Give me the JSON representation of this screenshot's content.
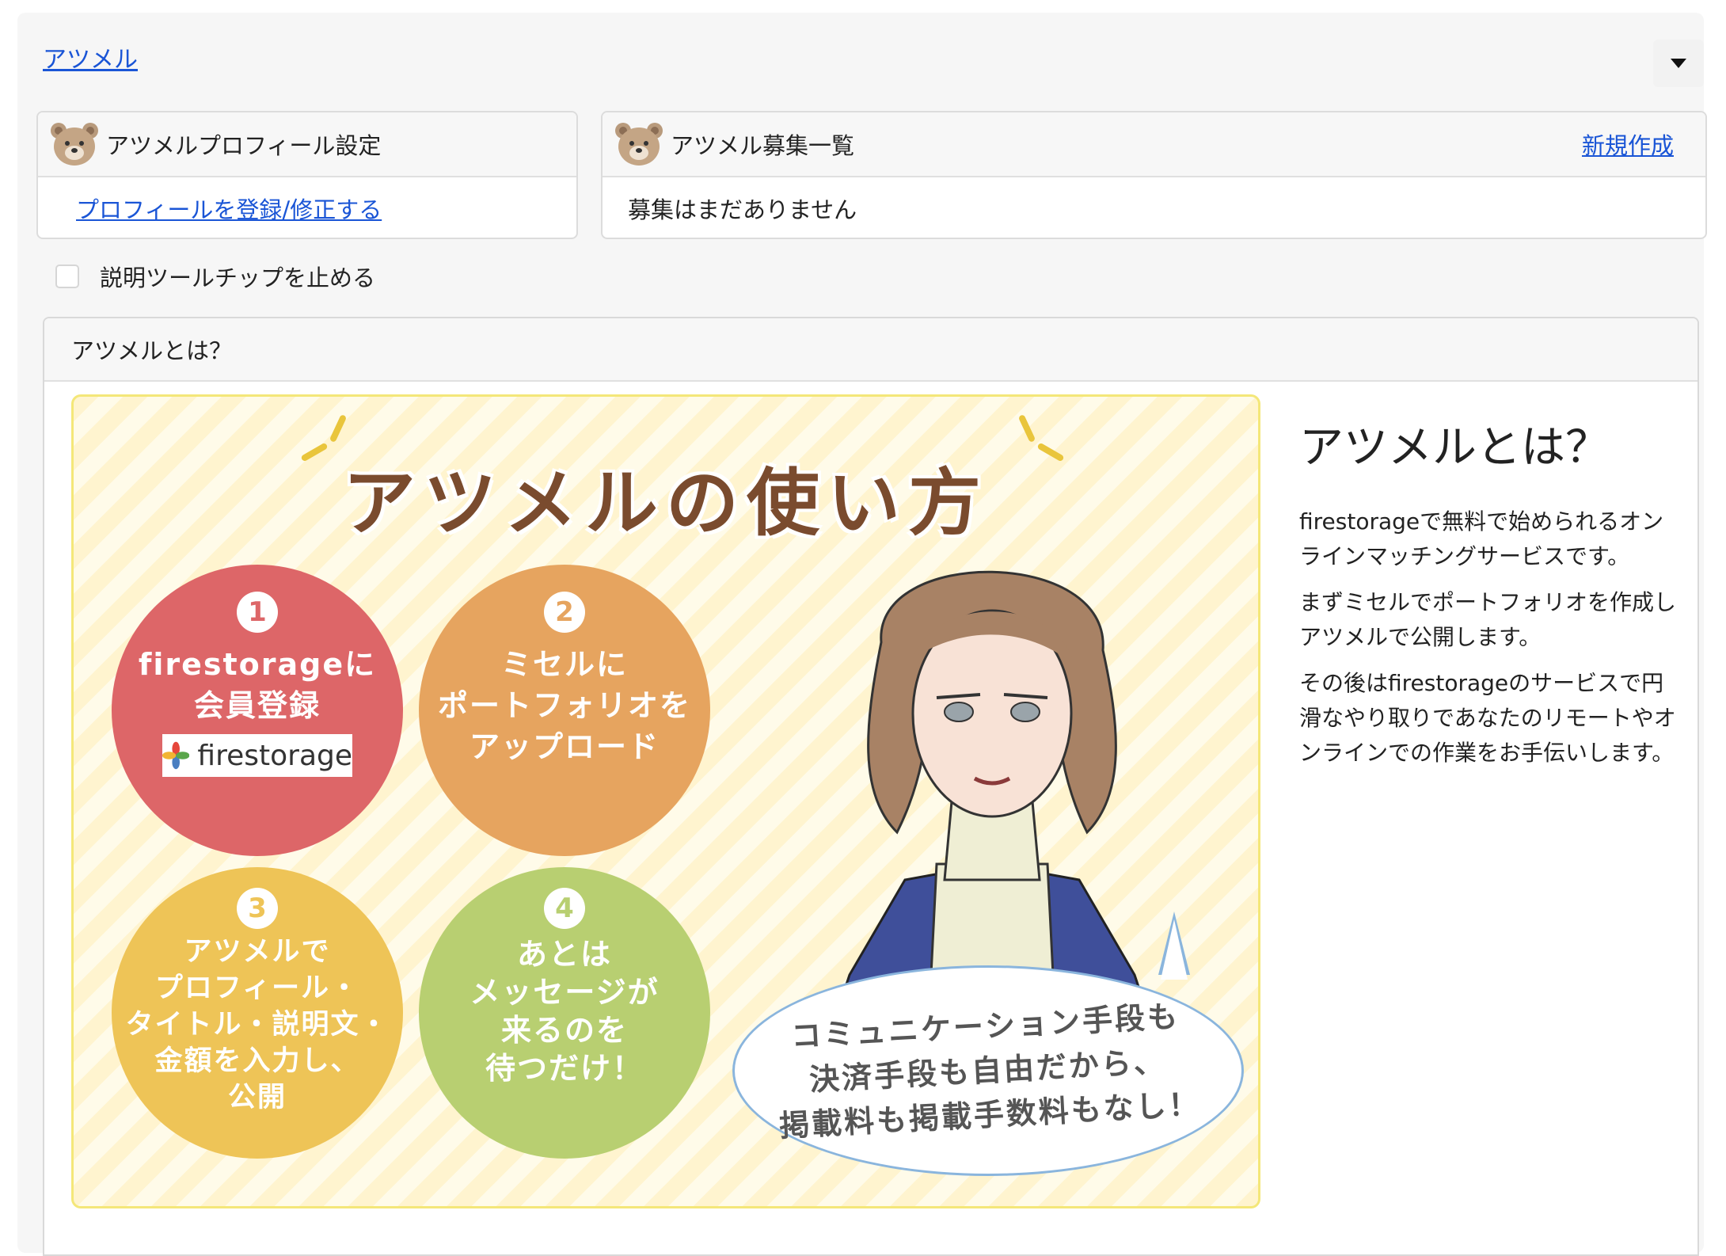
{
  "top_link": "アツメル",
  "profile_card": {
    "title": "アツメルプロフィール設定",
    "link": "プロフィールを登録/修正する"
  },
  "recruit_card": {
    "title": "アツメル募集一覧",
    "new_link": "新規作成",
    "empty_text": "募集はまだありません"
  },
  "tooltip_checkbox": {
    "label": "説明ツールチップを止める",
    "checked": false
  },
  "about": {
    "header": "アツメルとは？",
    "banner": {
      "title": "アツメルの使い方",
      "steps": [
        {
          "num": "1",
          "text": "firestorageに\n会員登録",
          "color": "#dd6668"
        },
        {
          "num": "2",
          "text": "ミセルに\nポートフォリオを\nアップロード",
          "color": "#e6a45f"
        },
        {
          "num": "3",
          "text": "アツメルで\nプロフィール・\nタイトル・説明文・\n金額を入力し、\n公開",
          "color": "#eec457"
        },
        {
          "num": "4",
          "text": "あとは\nメッセージが\n来るのを\n待つだけ！",
          "color": "#b8cf71"
        }
      ],
      "logo_text": "firestorage",
      "speech": "コミュニケーション手段も\n決済手段も自由だから、\n掲載料も掲載手数料もなし！"
    },
    "side_title": "アツメルとは？",
    "paragraphs": [
      "firestorageで無料で始められるオンラインマッチングサービスです。",
      "まずミセルでポートフォリオを作成しアツメルで公開します。",
      "その後はfirestorageのサービスで円滑なやり取りであなたのリモートやオンラインでの作業をお手伝いします。"
    ]
  }
}
